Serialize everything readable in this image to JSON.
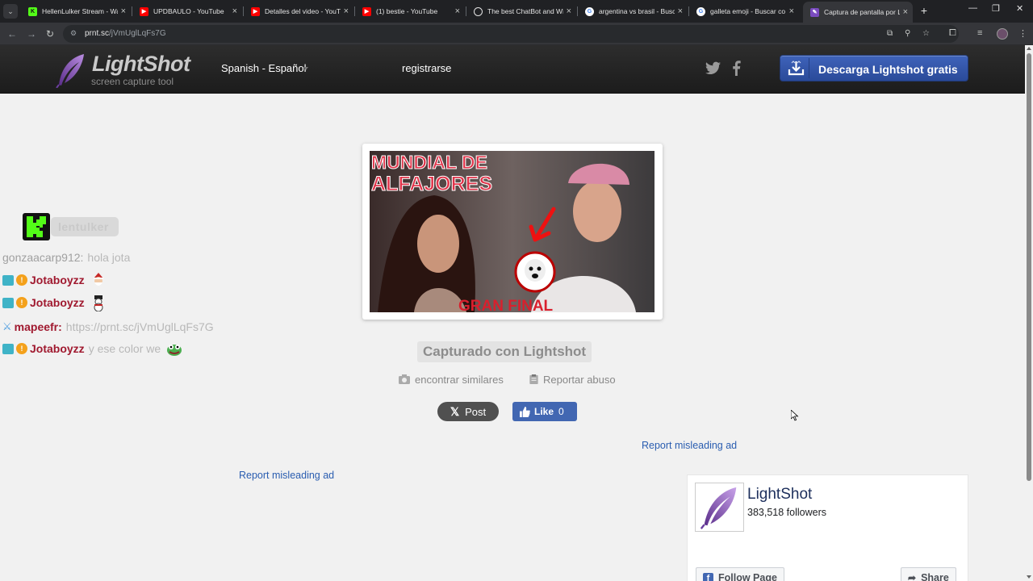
{
  "browser": {
    "tabs": [
      {
        "title": "HellenLulker Stream - Wa",
        "favicon": "kick-icon",
        "color": "#53fc18"
      },
      {
        "title": "UPDBAULO - YouTube",
        "favicon": "youtube-icon",
        "color": "#ff0000"
      },
      {
        "title": "Detalles del video - YouTu",
        "favicon": "youtube-studio-icon",
        "color": "#ff0000"
      },
      {
        "title": "(1) bestie - YouTube",
        "favicon": "youtube-icon",
        "color": "#ff0000"
      },
      {
        "title": "The best ChatBot and Wi",
        "favicon": "chatbot-icon",
        "color": "#e3e3e3"
      },
      {
        "title": "argentina vs brasil - Busc",
        "favicon": "google-icon",
        "color": "#ffffff"
      },
      {
        "title": "galleta emoji - Buscar co",
        "favicon": "google-icon",
        "color": "#ffffff"
      },
      {
        "title": "Captura de pantalla por L",
        "favicon": "lightshot-icon",
        "color": "#7a4bbf"
      }
    ],
    "url_host": "prnt.sc",
    "url_path": "/jVmUglLqFs7G"
  },
  "site": {
    "logo_name": "LightShot",
    "logo_tagline": "screen capture tool",
    "language": "Spanish - Español",
    "register_label": "registrarse",
    "download_label": "Descarga Lightshot gratis",
    "accent_color": "#2f52a8"
  },
  "chat": {
    "brand": "lentulker",
    "lines": [
      {
        "user": "gonzaacarp912",
        "sep": ":",
        "message": "hola jota",
        "user_color": "#a0a0a0",
        "badges": []
      },
      {
        "user": "Jotaboyzz",
        "sep": "",
        "message": "",
        "user_color": "#a0192f",
        "badges": [
          "sub",
          "coin"
        ],
        "emote": "santa-emote"
      },
      {
        "user": "Jotaboyzz",
        "sep": "",
        "message": "",
        "user_color": "#a0192f",
        "badges": [
          "sub",
          "coin"
        ],
        "emote": "snowman-emote"
      },
      {
        "user": "mapeefr",
        "sep": ":",
        "message": "https://prnt.sc/jVmUglLqFs7G",
        "user_color": "#a0192f",
        "badges": [
          "mod"
        ]
      },
      {
        "user": "Jotaboyzz",
        "sep": "",
        "message": "y ese color we",
        "user_color": "#a0192f",
        "badges": [
          "sub",
          "coin"
        ],
        "emote": "pepe-emote"
      }
    ]
  },
  "screenshot": {
    "caption_line1": "MUNDIAL DE",
    "caption_line2": "ALFAJORES",
    "bottom_text": "GRAN FINAL"
  },
  "captured_label": "Capturado con Lightshot",
  "links": {
    "find_similar": "encontrar similares",
    "report_abuse": "Reportar abuso",
    "report_ad": "Report misleading ad"
  },
  "social": {
    "tweet_label": "Post",
    "like_label": "Like",
    "like_count": "0"
  },
  "fb_widget": {
    "page_name": "LightShot",
    "followers": "383,518 followers",
    "follow_label": "Follow Page",
    "share_label": "Share"
  }
}
